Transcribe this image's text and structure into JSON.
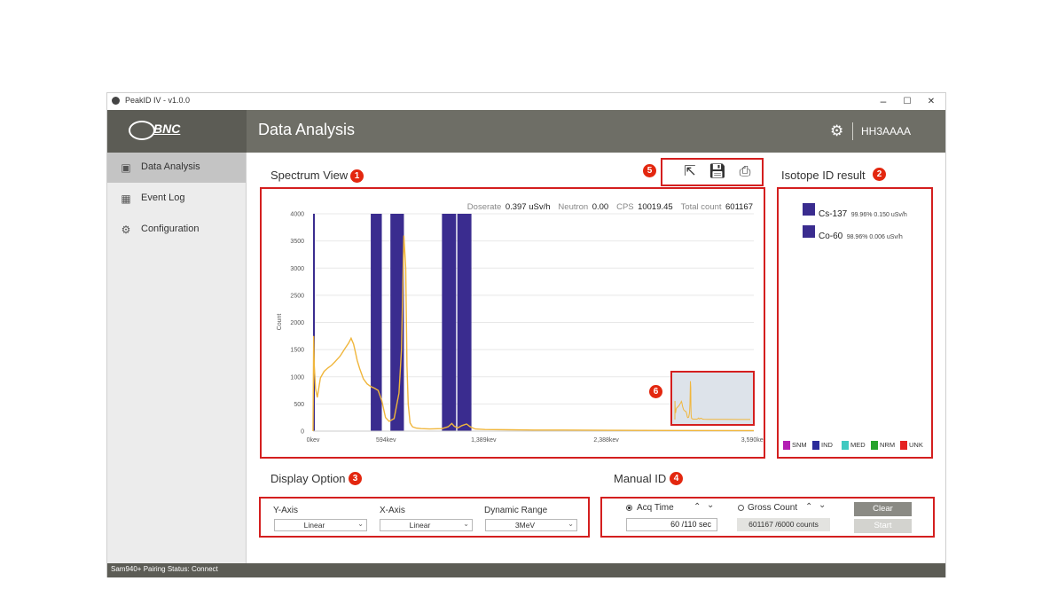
{
  "window": {
    "title": "PeakID IV - v1.0.0",
    "minimize": "–",
    "maximize": "☐",
    "close": "✕"
  },
  "header": {
    "logo_text": "BNC",
    "page_title": "Data Analysis",
    "device_id": "HH3AAAA"
  },
  "sidebar": {
    "items": [
      {
        "label": "Data Analysis",
        "icon": "monitor-icon",
        "active": true
      },
      {
        "label": "Event Log",
        "icon": "calendar-icon",
        "active": false
      },
      {
        "label": "Configuration",
        "icon": "gear-icon",
        "active": false
      }
    ]
  },
  "spectrum": {
    "title": "Spectrum View",
    "badge": "1",
    "toolbar_badge": "5",
    "inset_badge": "6",
    "stats": {
      "doserate_label": "Doserate",
      "doserate_value": "0.397 uSv/h",
      "neutron_label": "Neutron",
      "neutron_value": "0.00",
      "cps_label": "CPS",
      "cps_value": "10019.45",
      "total_label": "Total count",
      "total_value": "601167"
    }
  },
  "chart_data": {
    "type": "line",
    "ylabel": "Count",
    "ylim": [
      0,
      4000
    ],
    "y_ticks": [
      "0",
      "500",
      "1000",
      "1500",
      "2000",
      "2500",
      "3000",
      "3500",
      "4000"
    ],
    "x_ticks": [
      "0kev",
      "594kev",
      "1,389kev",
      "2,388kev",
      "3,590kev"
    ],
    "xlim": [
      0,
      3590
    ],
    "series_color": "#f0b63c",
    "band_color": "#3a2c8f",
    "bands": [
      [
        0,
        10
      ],
      [
        470,
        560
      ],
      [
        630,
        740
      ],
      [
        1050,
        1165
      ],
      [
        1175,
        1290
      ]
    ],
    "x": [
      0,
      5,
      10,
      20,
      35,
      60,
      90,
      120,
      150,
      180,
      220,
      260,
      290,
      310,
      330,
      345,
      360,
      380,
      410,
      440,
      470,
      500,
      530,
      560,
      590,
      620,
      660,
      700,
      720,
      740,
      755,
      765,
      775,
      790,
      810,
      840,
      880,
      950,
      1050,
      1100,
      1130,
      1150,
      1180,
      1210,
      1250,
      1280,
      1320,
      1400,
      1600,
      1800,
      2000,
      2400,
      3000,
      3590
    ],
    "y": [
      0,
      1750,
      1200,
      780,
      620,
      980,
      1100,
      1160,
      1210,
      1280,
      1380,
      1520,
      1620,
      1710,
      1600,
      1450,
      1300,
      1150,
      960,
      870,
      820,
      790,
      750,
      560,
      250,
      180,
      230,
      700,
      1500,
      3600,
      3000,
      1200,
      500,
      150,
      80,
      55,
      45,
      40,
      45,
      80,
      140,
      90,
      60,
      100,
      130,
      80,
      40,
      30,
      25,
      20,
      20,
      15,
      12,
      10
    ]
  },
  "isotope": {
    "title": "Isotope ID result",
    "badge": "2",
    "items": [
      {
        "name": "Cs-137",
        "detail": "99.96% 0.150 uSv/h"
      },
      {
        "name": "Co-60",
        "detail": "98.96% 0.006 uSv/h"
      }
    ],
    "legend": [
      {
        "label": "SNM",
        "color": "#b31fb3"
      },
      {
        "label": "IND",
        "color": "#2b2b9a"
      },
      {
        "label": "MED",
        "color": "#3fc9c0"
      },
      {
        "label": "NRM",
        "color": "#27a32d"
      },
      {
        "label": "UNK",
        "color": "#e52222"
      }
    ]
  },
  "display_option": {
    "title": "Display Option",
    "badge": "3",
    "y_axis": {
      "label": "Y-Axis",
      "value": "Linear"
    },
    "x_axis": {
      "label": "X-Axis",
      "value": "Linear"
    },
    "dynamic_range": {
      "label": "Dynamic Range",
      "value": "3MeV"
    }
  },
  "manual_id": {
    "title": "Manual ID",
    "badge": "4",
    "acq_time_label": "Acq Time",
    "acq_time_value": "60 /110 sec",
    "gross_count_label": "Gross Count",
    "gross_count_value": "601167 /6000 counts",
    "clear_label": "Clear",
    "start_label": "Start",
    "up": "⌃",
    "down": "⌄"
  },
  "status_bar": {
    "text": "Sam940+ Pairing Status:  Connect"
  }
}
